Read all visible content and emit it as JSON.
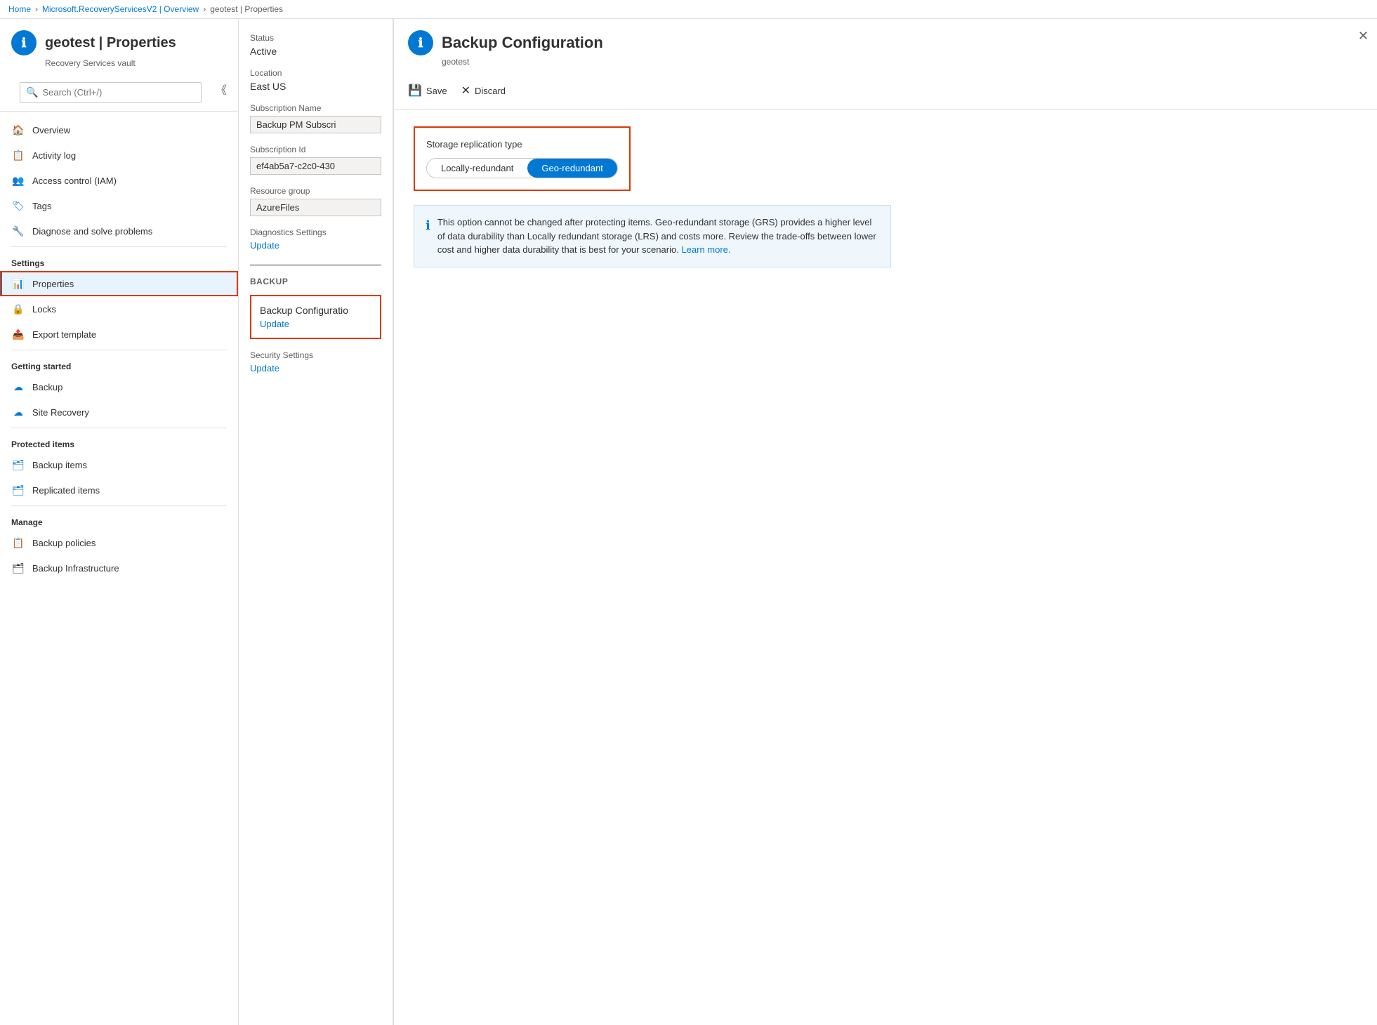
{
  "breadcrumb": {
    "items": [
      "Home",
      "Microsoft.RecoveryServicesV2 | Overview",
      "geotest | Properties"
    ]
  },
  "left_panel": {
    "title": "geotest | Properties",
    "subtitle": "Recovery Services vault",
    "search_placeholder": "Search (Ctrl+/)",
    "nav": {
      "top_items": [
        {
          "id": "overview",
          "label": "Overview",
          "icon": "🏠"
        },
        {
          "id": "activity-log",
          "label": "Activity log",
          "icon": "📋"
        },
        {
          "id": "access-control",
          "label": "Access control (IAM)",
          "icon": "👥"
        },
        {
          "id": "tags",
          "label": "Tags",
          "icon": "🏷"
        },
        {
          "id": "diagnose",
          "label": "Diagnose and solve problems",
          "icon": "🔧"
        }
      ],
      "settings_section": "Settings",
      "settings_items": [
        {
          "id": "properties",
          "label": "Properties",
          "icon": "📊",
          "active": true
        },
        {
          "id": "locks",
          "label": "Locks",
          "icon": "🔒"
        },
        {
          "id": "export-template",
          "label": "Export template",
          "icon": "📤"
        }
      ],
      "getting_started_section": "Getting started",
      "getting_started_items": [
        {
          "id": "backup",
          "label": "Backup",
          "icon": "☁"
        },
        {
          "id": "site-recovery",
          "label": "Site Recovery",
          "icon": "☁"
        }
      ],
      "protected_items_section": "Protected items",
      "protected_items": [
        {
          "id": "backup-items",
          "label": "Backup items",
          "icon": "🗂"
        },
        {
          "id": "replicated-items",
          "label": "Replicated items",
          "icon": "🗂"
        }
      ],
      "manage_section": "Manage",
      "manage_items": [
        {
          "id": "backup-policies",
          "label": "Backup policies",
          "icon": "📋"
        },
        {
          "id": "backup-infrastructure",
          "label": "Backup Infrastructure",
          "icon": "🗂"
        }
      ]
    }
  },
  "middle_panel": {
    "status_label": "Status",
    "status_value": "Active",
    "location_label": "Location",
    "location_value": "East US",
    "subscription_name_label": "Subscription Name",
    "subscription_name_value": "Backup PM Subscri",
    "subscription_id_label": "Subscription Id",
    "subscription_id_value": "ef4ab5a7-c2c0-430",
    "resource_group_label": "Resource group",
    "resource_group_value": "AzureFiles",
    "diagnostics_label": "Diagnostics Settings",
    "diagnostics_link": "Update",
    "backup_section_label": "BACKUP",
    "backup_config_title": "Backup Configuratio",
    "backup_config_link": "Update",
    "security_settings_label": "Security Settings",
    "security_settings_link": "Update"
  },
  "right_panel": {
    "title": "Backup Configuration",
    "subtitle": "geotest",
    "save_label": "Save",
    "discard_label": "Discard",
    "storage_replication_label": "Storage replication type",
    "toggle_options": [
      "Locally-redundant",
      "Geo-redundant"
    ],
    "selected_option": "Geo-redundant",
    "info_text": "This option cannot be changed after protecting items. Geo-redundant storage (GRS) provides a higher level of data durability than Locally redundant storage (LRS) and costs more. Review the trade-offs between lower cost and higher data durability that is best for your scenario.",
    "info_link": "Learn more."
  }
}
